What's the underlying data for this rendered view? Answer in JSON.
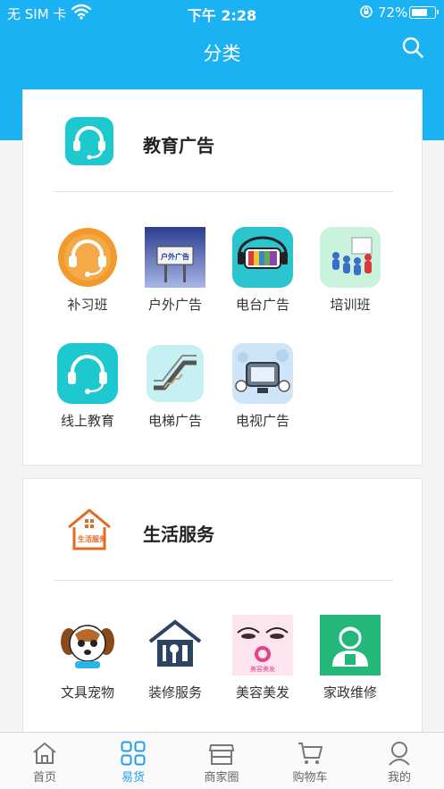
{
  "status_bar": {
    "carrier": "无 SIM 卡",
    "time": "下午 2:28",
    "battery": "72%",
    "battery_level": 0.72
  },
  "header": {
    "title": "分类"
  },
  "colors": {
    "brand": "#1bb2f3",
    "active_tab": "#1e9ef0"
  },
  "sections": [
    {
      "title": "教育广告",
      "icon": "headset-icon",
      "items": [
        {
          "label": "补习班",
          "icon": "tutor-headset-icon"
        },
        {
          "label": "户外广告",
          "icon": "billboard-icon"
        },
        {
          "label": "电台广告",
          "icon": "radio-icon"
        },
        {
          "label": "培训班",
          "icon": "training-icon"
        },
        {
          "label": "线上教育",
          "icon": "online-headset-icon"
        },
        {
          "label": "电梯广告",
          "icon": "escalator-icon"
        },
        {
          "label": "电视广告",
          "icon": "tv-icon"
        }
      ]
    },
    {
      "title": "生活服务",
      "icon": "house-icon",
      "icon_text": "生活服务",
      "items": [
        {
          "label": "文具宠物",
          "icon": "dog-icon"
        },
        {
          "label": "装修服务",
          "icon": "renovation-icon"
        },
        {
          "label": "美容美发",
          "icon": "beauty-icon",
          "icon_text": "美容美发"
        },
        {
          "label": "家政维修",
          "icon": "housekeeper-icon"
        }
      ]
    }
  ],
  "tabbar": [
    {
      "label": "首页",
      "icon": "home-icon"
    },
    {
      "label": "易货",
      "icon": "grid-icon",
      "active": true
    },
    {
      "label": "商家圈",
      "icon": "store-icon"
    },
    {
      "label": "购物车",
      "icon": "cart-icon"
    },
    {
      "label": "我的",
      "icon": "user-icon"
    }
  ]
}
